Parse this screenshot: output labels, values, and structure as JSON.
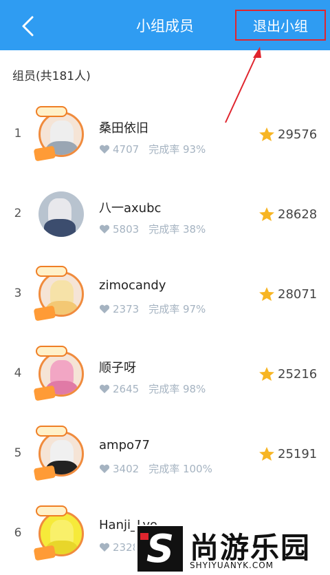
{
  "header": {
    "title": "小组成员",
    "quit_label": "退出小组",
    "back_icon": "chevron-left-icon",
    "background": "#2f9cf2"
  },
  "annotation_color": "#e0252e",
  "members_heading": "组员(共181人)",
  "members": [
    {
      "rank": "1",
      "name": "桑田依旧",
      "likes": "4707",
      "completion": "完成率 93%",
      "score": "29576",
      "avatar": "decorated"
    },
    {
      "rank": "2",
      "name": "八一axubc",
      "likes": "5803",
      "completion": "完成率 38%",
      "score": "28628",
      "avatar": "plain"
    },
    {
      "rank": "3",
      "name": "zimocandy",
      "likes": "2373",
      "completion": "完成率 97%",
      "score": "28071",
      "avatar": "decorated"
    },
    {
      "rank": "4",
      "name": "顺子呀",
      "likes": "2645",
      "completion": "完成率 98%",
      "score": "25216",
      "avatar": "decorated"
    },
    {
      "rank": "5",
      "name": "ampo77",
      "likes": "3402",
      "completion": "完成率 100%",
      "score": "25191",
      "avatar": "decorated"
    },
    {
      "rank": "6",
      "name": "Hanji_Lyo",
      "likes": "2328",
      "completion": "",
      "score": "",
      "avatar": "decorated"
    }
  ],
  "watermark": {
    "letter": "S",
    "text": "尚游乐园",
    "url": "SHYIYUANYK.COM"
  }
}
